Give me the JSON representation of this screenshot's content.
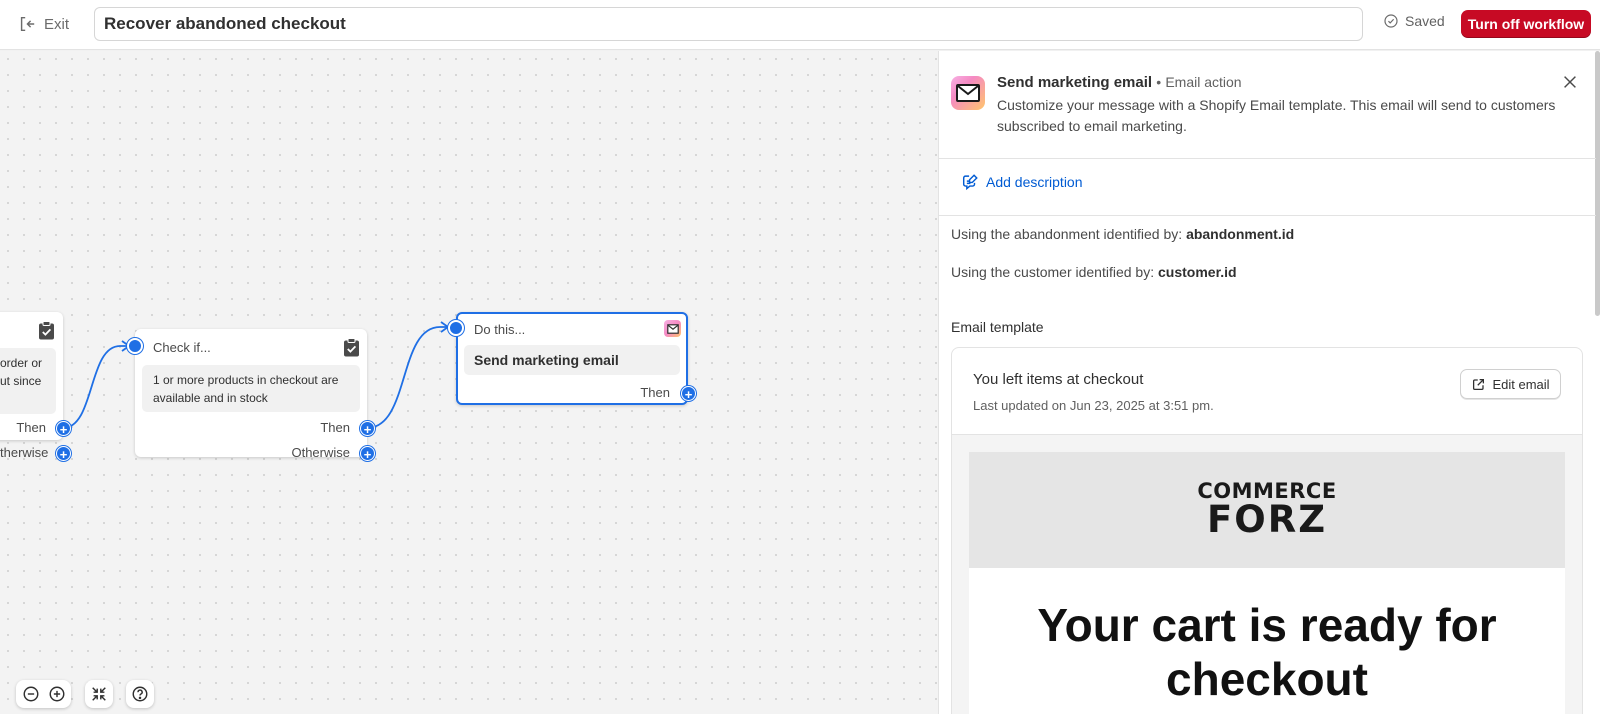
{
  "topbar": {
    "exit_label": "Exit",
    "workflow_title": "Recover abandoned checkout",
    "saved_label": "Saved",
    "turn_off_label": "Turn off workflow"
  },
  "canvas": {
    "partial_node": {
      "body_line1": "order or",
      "body_line2": "ut since",
      "then_label": "Then",
      "otherwise_label": "therwise"
    },
    "condition_node": {
      "head": "Check if...",
      "body": "1 or more products in checkout are available and in stock",
      "then_label": "Then",
      "otherwise_label": "Otherwise"
    },
    "action_node": {
      "head": "Do this...",
      "body": "Send marketing email",
      "then_label": "Then"
    }
  },
  "panel": {
    "title": "Send marketing email",
    "separator": "•",
    "subtitle": "Email action",
    "description": "Customize your message with a Shopify Email template. This email will send to customers subscribed to email marketing.",
    "add_description_label": "Add description",
    "abandonment_prefix": "Using the abandonment identified by:",
    "abandonment_value": "abandonment.id",
    "customer_prefix": "Using the customer identified by:",
    "customer_value": "customer.id",
    "email_template_label": "Email template",
    "email": {
      "subject": "You left items at checkout",
      "last_updated": "Last updated on Jun 23, 2025 at 3:51 pm.",
      "edit_label": "Edit email",
      "logo_line1": "COMMERCE",
      "logo_line2": "FORZ",
      "hero_text": "Your cart is ready for checkout"
    }
  },
  "colors": {
    "accent_blue": "#1f6fe5",
    "danger_red": "#c70a24",
    "link_blue": "#005bd3"
  }
}
